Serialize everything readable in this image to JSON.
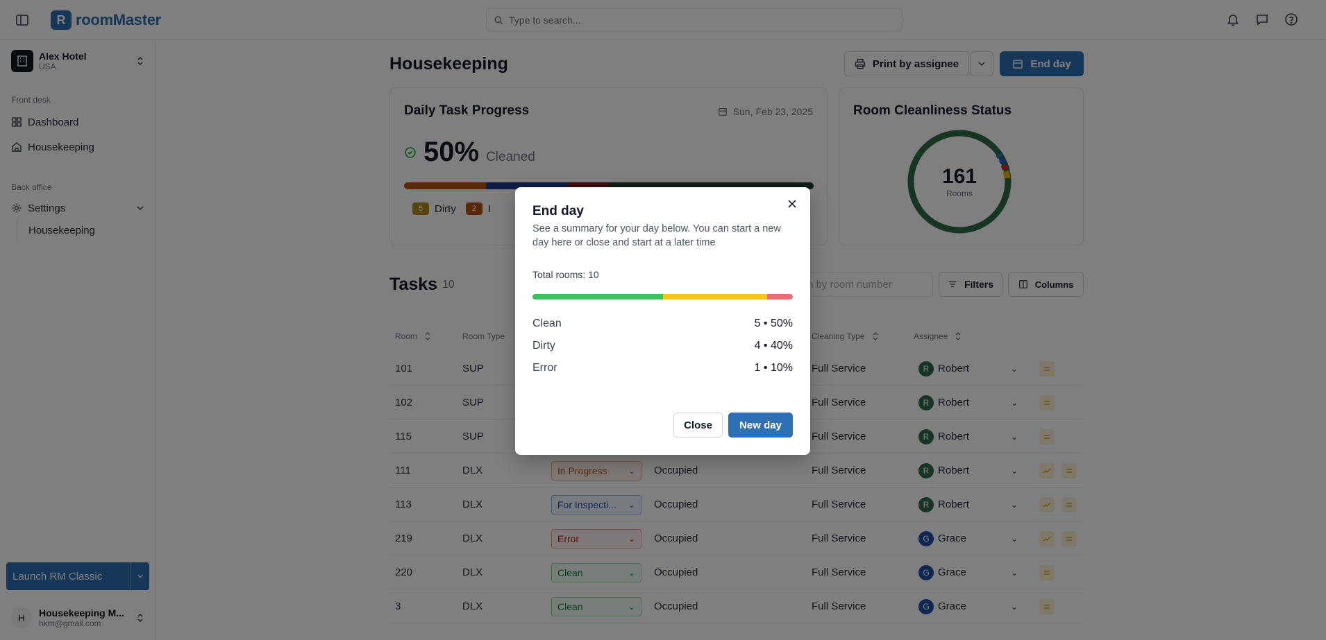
{
  "app": {
    "brand": "roomMaster",
    "search_placeholder": "Type to search..."
  },
  "hotel": {
    "name": "Alex Hotel",
    "country": "USA"
  },
  "nav": {
    "front_desk_label": "Front desk",
    "dashboard": "Dashboard",
    "housekeeping": "Housekeeping",
    "back_office_label": "Back office",
    "settings": "Settings",
    "settings_housekeeping": "Housekeeping"
  },
  "launch": {
    "label": "Launch RM Classic"
  },
  "user": {
    "initial": "H",
    "name": "Housekeeping M...",
    "email": "hkm@gmail.com"
  },
  "page": {
    "title": "Housekeeping",
    "print_btn": "Print by assignee",
    "end_day_btn": "End day"
  },
  "progress_card": {
    "title": "Daily Task Progress",
    "date": "Sun, Feb 23, 2025",
    "percent": "50%",
    "percent_label": "Cleaned",
    "bar_segments": [
      {
        "color": "#b44e0e",
        "value": 0.2
      },
      {
        "color": "#1e3a8a",
        "value": 0.2
      },
      {
        "color": "#7f1d1d",
        "value": 0.1
      },
      {
        "color": "#1e3d2a",
        "value": 0.5
      }
    ],
    "legend": [
      {
        "count": "5",
        "label": "Dirty",
        "color": "#b08a1a"
      },
      {
        "count": "2",
        "label": "I",
        "color": "#b44e0e"
      }
    ]
  },
  "cleanliness_card": {
    "title": "Room Cleanliness Status",
    "total": "161",
    "total_label": "Rooms"
  },
  "tasks": {
    "title": "Tasks",
    "count": "10",
    "search_placeholder": "h by room number",
    "filters_btn": "Filters",
    "columns_btn": "Columns",
    "headers": {
      "room": "Room",
      "room_type": "Room Type",
      "cleaning_type": "Cleaning Type",
      "assignee": "Assignee"
    },
    "rows": [
      {
        "room": "101",
        "type": "SUP",
        "status": "",
        "occupancy": "",
        "cleaning": "Full Service",
        "assignee": "Robert",
        "initial": "R"
      },
      {
        "room": "102",
        "type": "SUP",
        "status": "",
        "occupancy": "",
        "cleaning": "Full Service",
        "assignee": "Robert",
        "initial": "R"
      },
      {
        "room": "115",
        "type": "SUP",
        "status": "",
        "occupancy": "",
        "cleaning": "Full Service",
        "assignee": "Robert",
        "initial": "R"
      },
      {
        "room": "111",
        "type": "DLX",
        "status": "In Progress",
        "occupancy": "Occupied",
        "cleaning": "Full Service",
        "assignee": "Robert",
        "initial": "R"
      },
      {
        "room": "113",
        "type": "DLX",
        "status": "For Inspecti...",
        "occupancy": "Occupied",
        "cleaning": "Full Service",
        "assignee": "Robert",
        "initial": "R"
      },
      {
        "room": "219",
        "type": "DLX",
        "status": "Error",
        "occupancy": "Occupied",
        "cleaning": "Full Service",
        "assignee": "Grace",
        "initial": "G"
      },
      {
        "room": "220",
        "type": "DLX",
        "status": "Clean",
        "occupancy": "Occupied",
        "cleaning": "Full Service",
        "assignee": "Grace",
        "initial": "G"
      },
      {
        "room": "3",
        "type": "DLX",
        "status": "Clean",
        "occupancy": "Occupied",
        "cleaning": "Full Service",
        "assignee": "Grace",
        "initial": "G"
      }
    ]
  },
  "modal": {
    "title": "End day",
    "description": "See a summary for your day below. You can start a new day here or close and start at a later time",
    "total_rooms": "Total rooms: 10",
    "bar": [
      {
        "color": "#3cc25a",
        "value": 0.5
      },
      {
        "color": "#f5c518",
        "value": 0.4
      },
      {
        "color": "#ef6b73",
        "value": 0.1
      }
    ],
    "stats": [
      {
        "label": "Clean",
        "value": "5 • 50%"
      },
      {
        "label": "Dirty",
        "value": "4 • 40%"
      },
      {
        "label": "Error",
        "value": "1 • 10%"
      }
    ],
    "close_btn": "Close",
    "new_day_btn": "New day"
  }
}
